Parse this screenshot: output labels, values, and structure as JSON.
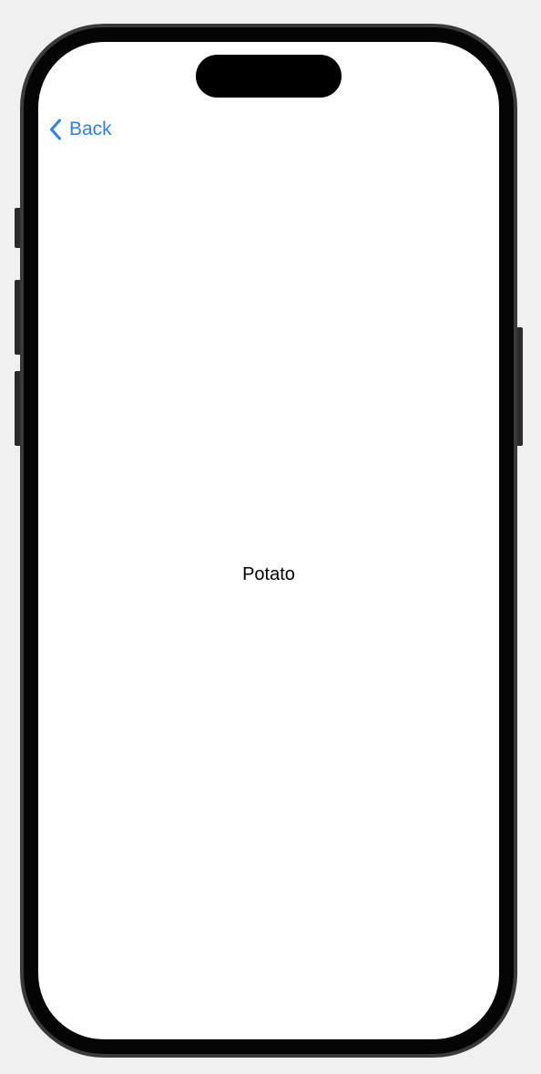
{
  "nav": {
    "back_label": "Back",
    "back_icon": "chevron-left-icon"
  },
  "content": {
    "text": "Potato"
  },
  "colors": {
    "accent": "#2f80ed",
    "background": "#ffffff",
    "device_frame": "#050505",
    "page_background": "#f0f0f0"
  }
}
